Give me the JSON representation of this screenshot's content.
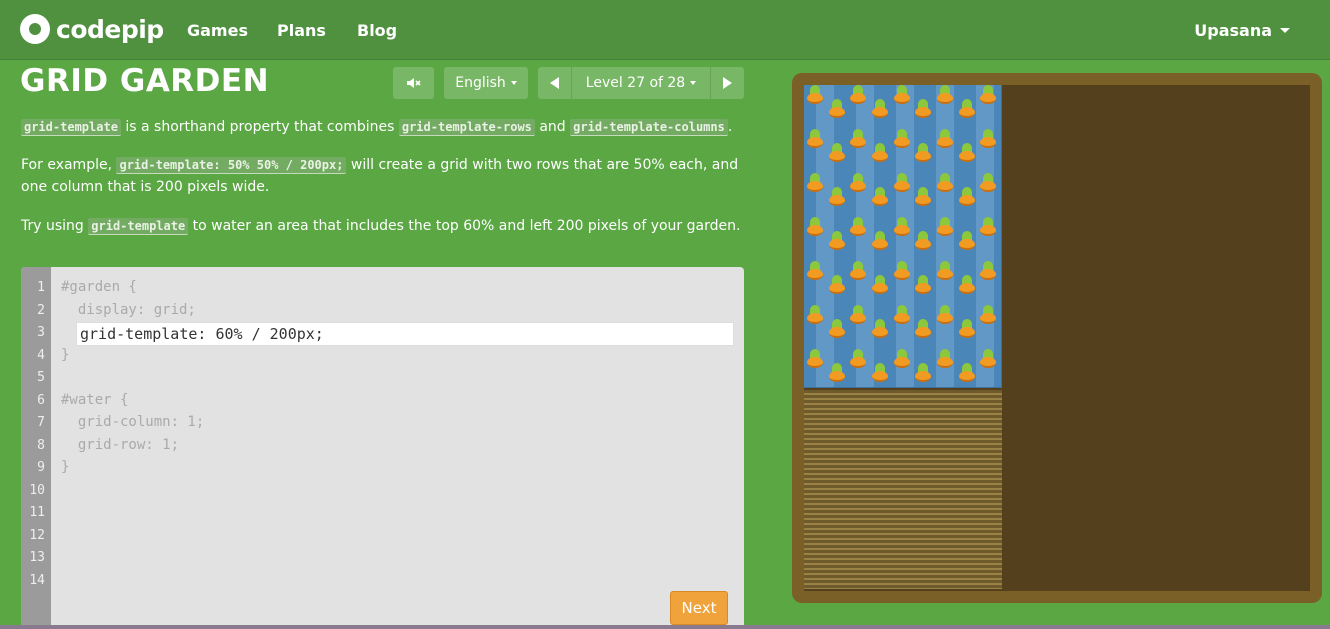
{
  "nav": {
    "logo_text": "codepip",
    "links": [
      "Games",
      "Plans",
      "Blog"
    ],
    "user": "Upasana"
  },
  "header": {
    "title": "GRID GARDEN",
    "mute_icon": "speaker-mute-icon",
    "language": "English",
    "level_label": "Level 27 of 28"
  },
  "instructions": {
    "p1": {
      "kw1": "grid-template",
      "t1": " is a shorthand property that combines ",
      "kw2": "grid-template-rows",
      "t2": " and ",
      "kw3": "grid-template-columns",
      "t3": "."
    },
    "p2": {
      "t0": "For example, ",
      "kw1": "grid-template: 50% 50% / 200px;",
      "t1": " will create a grid with two rows that are 50% each, and one column that is 200 pixels wide."
    },
    "p3": {
      "t0": "Try using ",
      "kw1": "grid-template",
      "t1": " to water an area that includes the top 60% and left 200 pixels of your garden."
    }
  },
  "editor": {
    "line_numbers": [
      "1",
      "2",
      "3",
      "4",
      "5",
      "6",
      "7",
      "8",
      "9",
      "10",
      "11",
      "12",
      "13",
      "14"
    ],
    "line1": "#garden {",
    "line2": "  display: grid;",
    "input_value": "grid-template: 60% / 200px;",
    "line4": "}",
    "line6": "#water {",
    "line7": "  grid-column: 1;",
    "line8": "  grid-row: 1;",
    "line9": "}",
    "next_label": "Next"
  },
  "colors": {
    "background": "#5aa744",
    "nav": "#509140",
    "water": "#4b86b8",
    "soil": "#55401d",
    "next_button": "#f0a33a"
  }
}
